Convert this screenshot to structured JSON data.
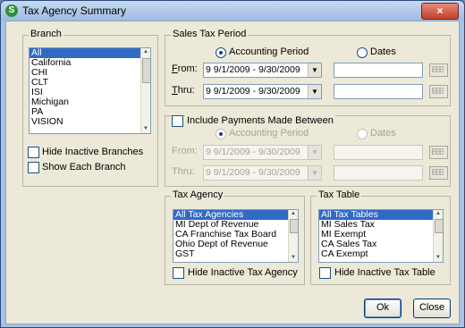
{
  "window": {
    "title": "Tax Agency Summary",
    "close_glyph": "×",
    "icon_letter": "S"
  },
  "branch": {
    "label": "Branch",
    "items": [
      "All",
      "California",
      "CHI",
      "CLT",
      "ISI",
      "Michigan",
      "PA",
      "VISION"
    ],
    "selected": "All",
    "hide_inactive_label": "Hide Inactive Branches",
    "show_each_label": "Show Each Branch"
  },
  "sales_tax_period": {
    "label": "Sales Tax Period",
    "accounting_period_label": "Accounting Period",
    "dates_label": "Dates",
    "selected_mode": "Accounting Period",
    "from_label": "From:",
    "thru_label": "Thru:",
    "from_value": "9   9/1/2009 - 9/30/2009",
    "thru_value": "9   9/1/2009 - 9/30/2009"
  },
  "payments_between": {
    "label": "Include Payments Made Between",
    "accounting_period_label": "Accounting Period",
    "dates_label": "Dates",
    "from_label": "From:",
    "thru_label": "Thru:",
    "from_value": "9   9/1/2009 - 9/30/2009",
    "thru_value": "9   9/1/2009 - 9/30/2009"
  },
  "tax_agency": {
    "label": "Tax Agency",
    "items": [
      "All Tax Agencies",
      "MI Dept of Revenue",
      "CA Franchise Tax Board",
      "Ohio Dept of Revenue",
      "GST"
    ],
    "selected": "All Tax Agencies",
    "hide_inactive_label": "Hide Inactive Tax Agency"
  },
  "tax_table": {
    "label": "Tax Table",
    "items": [
      "All Tax Tables",
      "MI Sales Tax",
      "MI Exempt",
      "CA Sales Tax",
      "CA Exempt"
    ],
    "selected": "All Tax Tables",
    "hide_inactive_label": "Hide Inactive Tax Table"
  },
  "buttons": {
    "ok": "Ok",
    "close": "Close"
  },
  "colors": {
    "selection": "#316ac5",
    "face": "#ece9d8",
    "title_gradient_top": "#c7daf2"
  }
}
